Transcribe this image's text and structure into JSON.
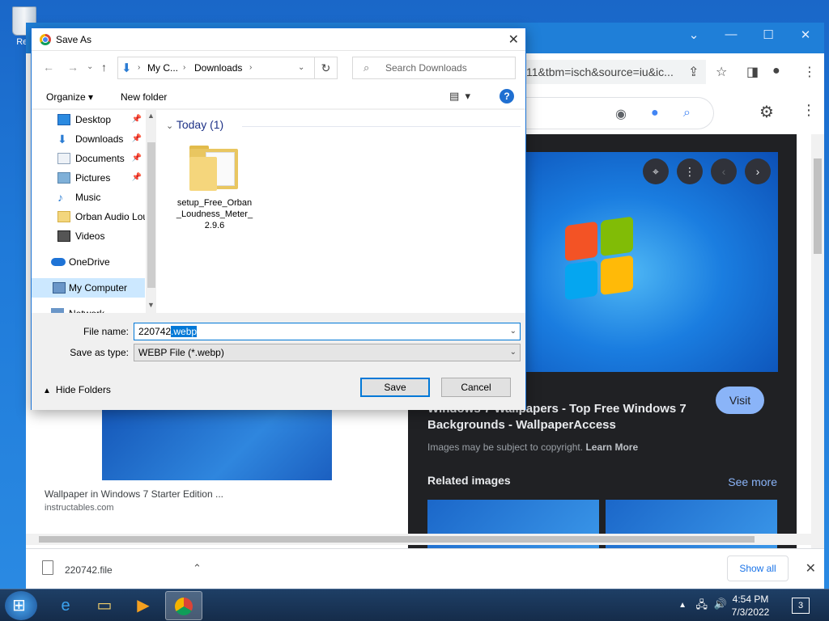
{
  "desktop": {
    "recycle_bin_label": "Rec"
  },
  "chrome": {
    "url_fragment": "11&tbm=isch&source=iu&ic...",
    "panel": {
      "title": "Windows 7 Wallpapers - Top Free Windows 7 Backgrounds - WallpaperAccess",
      "visit_label": "Visit",
      "copyright_note": "Images may be subject to copyright.",
      "learn_more": "Learn More",
      "related_images": "Related images",
      "see_more": "See more"
    },
    "left_result": {
      "caption": "Wallpaper in Windows 7 Starter Edition ...",
      "source": "instructables.com"
    },
    "download_bar": {
      "file_name": "220742.file",
      "show_all": "Show all"
    }
  },
  "dialog": {
    "title": "Save As",
    "breadcrumb": [
      "My C...",
      "Downloads"
    ],
    "search_placeholder": "Search Downloads",
    "toolbar": {
      "organize": "Organize",
      "new_folder": "New folder"
    },
    "nav_items": [
      {
        "label": "Desktop",
        "icon": "desktop-icon",
        "pinned": true
      },
      {
        "label": "Downloads",
        "icon": "downloads-icon",
        "pinned": true
      },
      {
        "label": "Documents",
        "icon": "documents-icon",
        "pinned": true
      },
      {
        "label": "Pictures",
        "icon": "pictures-icon",
        "pinned": true
      },
      {
        "label": "Music",
        "icon": "music-icon",
        "pinned": false
      },
      {
        "label": "Orban Audio Lou",
        "icon": "folder-icon",
        "pinned": false
      },
      {
        "label": "Videos",
        "icon": "videos-icon",
        "pinned": false
      },
      {
        "label": "OneDrive",
        "icon": "onedrive-icon",
        "pinned": false
      },
      {
        "label": "My Computer",
        "icon": "computer-icon",
        "pinned": false,
        "selected": true
      },
      {
        "label": "Network",
        "icon": "network-icon",
        "pinned": false
      }
    ],
    "group_header": "Today (1)",
    "files": [
      {
        "name": "setup_Free_Orban_Loudness_Meter_2.9.6"
      }
    ],
    "file_name_label": "File name:",
    "file_name_base": "220742",
    "file_name_ext": ".webp",
    "save_as_type_label": "Save as type:",
    "save_as_type_value": "WEBP File (*.webp)",
    "hide_folders": "Hide Folders",
    "save_button": "Save",
    "cancel_button": "Cancel"
  },
  "taskbar": {
    "time": "4:54 PM",
    "date": "7/3/2022",
    "notification_count": "3"
  },
  "colors": {
    "accent": "#0078d7",
    "chrome_blue": "#1f7fd8",
    "panel_bg": "#202124",
    "link": "#8ab4f8"
  }
}
